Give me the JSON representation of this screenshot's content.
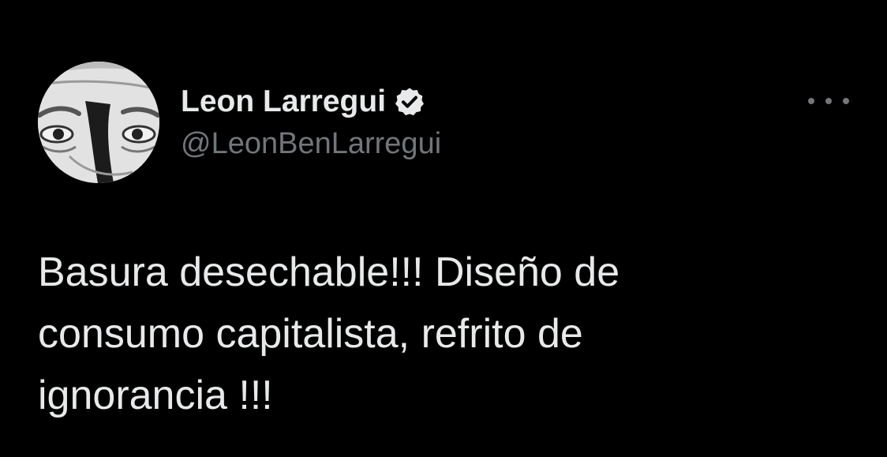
{
  "author": {
    "display_name": "Leon Larregui",
    "handle": "@LeonBenLarregui",
    "verified": true,
    "avatar_icon": "profile-photo-eyes"
  },
  "menu": {
    "icon": "more-horizontal-icon"
  },
  "tweet": {
    "text_lines": [
      "Basura desechable!!! Diseño de",
      "consumo capitalista, refrito de",
      "ignorancia !!!"
    ]
  },
  "colors": {
    "background": "#000000",
    "primary_text": "#e7e9ea",
    "secondary_text": "#71767b",
    "badge": "#e7e9ea"
  }
}
